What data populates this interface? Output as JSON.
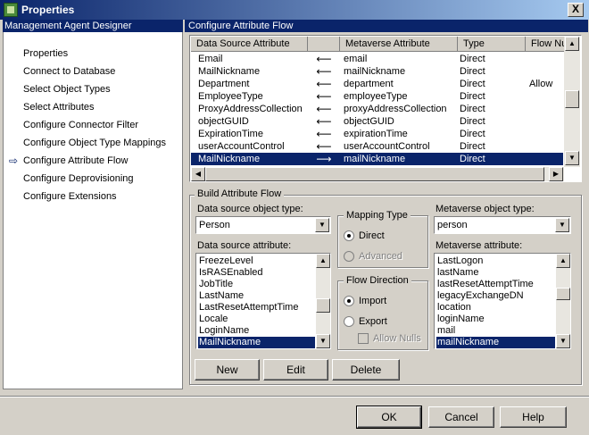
{
  "window": {
    "title": "Properties",
    "close_glyph": "X"
  },
  "nav": {
    "header": "Management Agent Designer",
    "items": [
      "Properties",
      "Connect to Database",
      "Select Object Types",
      "Select Attributes",
      "Configure Connector Filter",
      "Configure Object Type Mappings",
      "Configure Attribute Flow",
      "Configure Deprovisioning",
      "Configure Extensions"
    ],
    "active_index": 6,
    "active_glyph": "⇨"
  },
  "main": {
    "header": "Configure Attribute Flow"
  },
  "flow_table": {
    "columns": [
      "Data Source Attribute",
      "",
      "Metaverse Attribute",
      "Type",
      "Flow Nu"
    ],
    "rows": [
      {
        "src": "Email",
        "arrow": "⟵",
        "mv": "email",
        "type": "Direct",
        "flow": ""
      },
      {
        "src": "MailNickname",
        "arrow": "⟵",
        "mv": "mailNickname",
        "type": "Direct",
        "flow": ""
      },
      {
        "src": "Department",
        "arrow": "⟵",
        "mv": "department",
        "type": "Direct",
        "flow": "Allow"
      },
      {
        "src": "EmployeeType",
        "arrow": "⟵",
        "mv": "employeeType",
        "type": "Direct",
        "flow": ""
      },
      {
        "src": "ProxyAddressCollection",
        "arrow": "⟵",
        "mv": "proxyAddressCollection",
        "type": "Direct",
        "flow": ""
      },
      {
        "src": "objectGUID",
        "arrow": "⟵",
        "mv": "objectGUID",
        "type": "Direct",
        "flow": ""
      },
      {
        "src": "ExpirationTime",
        "arrow": "⟵",
        "mv": "expirationTime",
        "type": "Direct",
        "flow": ""
      },
      {
        "src": "userAccountControl",
        "arrow": "⟵",
        "mv": "userAccountControl",
        "type": "Direct",
        "flow": ""
      },
      {
        "src": "MailNickname",
        "arrow": "⟶",
        "mv": "mailNickname",
        "type": "Direct",
        "flow": ""
      }
    ],
    "selected_index": 8
  },
  "build": {
    "group_label": "Build Attribute Flow",
    "ds_object_type_label": "Data source object type:",
    "ds_object_type_value": "Person",
    "ds_attribute_label": "Data source attribute:",
    "ds_attributes": [
      "FreezeLevel",
      "IsRASEnabled",
      "JobTitle",
      "LastName",
      "LastResetAttemptTime",
      "Locale",
      "LoginName",
      "MailNickname"
    ],
    "ds_selected_index": 7,
    "mapping_type": {
      "label": "Mapping Type",
      "direct": "Direct",
      "advanced": "Advanced",
      "selected": "direct"
    },
    "flow_direction": {
      "label": "Flow Direction",
      "import": "Import",
      "export": "Export",
      "allow_nulls": "Allow Nulls",
      "selected": "import"
    },
    "mv_object_type_label": "Metaverse object type:",
    "mv_object_type_value": "person",
    "mv_attribute_label": "Metaverse attribute:",
    "mv_attributes": [
      "LastLogon",
      "lastName",
      "lastResetAttemptTime",
      "legacyExchangeDN",
      "location",
      "loginName",
      "mail",
      "mailNickname"
    ],
    "mv_selected_index": 7,
    "buttons": {
      "new": "New",
      "edit": "Edit",
      "delete": "Delete"
    }
  },
  "footer": {
    "ok": "OK",
    "cancel": "Cancel",
    "help": "Help"
  }
}
